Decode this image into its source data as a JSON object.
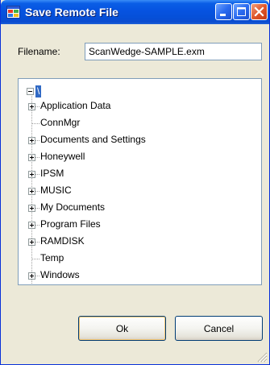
{
  "window": {
    "title": "Save Remote File",
    "controls": [
      "minimize-icon",
      "maximize-icon",
      "close-icon"
    ]
  },
  "colors": {
    "titlebar": "#0653e0",
    "selection": "#316ac5",
    "dialog_bg": "#ece9d8",
    "border": "#7f9db9"
  },
  "filename": {
    "label": "Filename:",
    "value": "ScanWedge-SAMPLE.exm"
  },
  "tree": {
    "root": {
      "label": "\\",
      "expanded": true,
      "selected": true
    },
    "items": [
      {
        "label": "Application Data",
        "expandable": true
      },
      {
        "label": "ConnMgr",
        "expandable": false
      },
      {
        "label": "Documents and Settings",
        "expandable": true
      },
      {
        "label": "Honeywell",
        "expandable": true
      },
      {
        "label": "IPSM",
        "expandable": true
      },
      {
        "label": "MUSIC",
        "expandable": true
      },
      {
        "label": "My Documents",
        "expandable": true
      },
      {
        "label": "Program Files",
        "expandable": true
      },
      {
        "label": "RAMDISK",
        "expandable": true
      },
      {
        "label": "Temp",
        "expandable": false
      },
      {
        "label": "Windows",
        "expandable": true
      }
    ]
  },
  "buttons": {
    "ok": "Ok",
    "cancel": "Cancel"
  }
}
